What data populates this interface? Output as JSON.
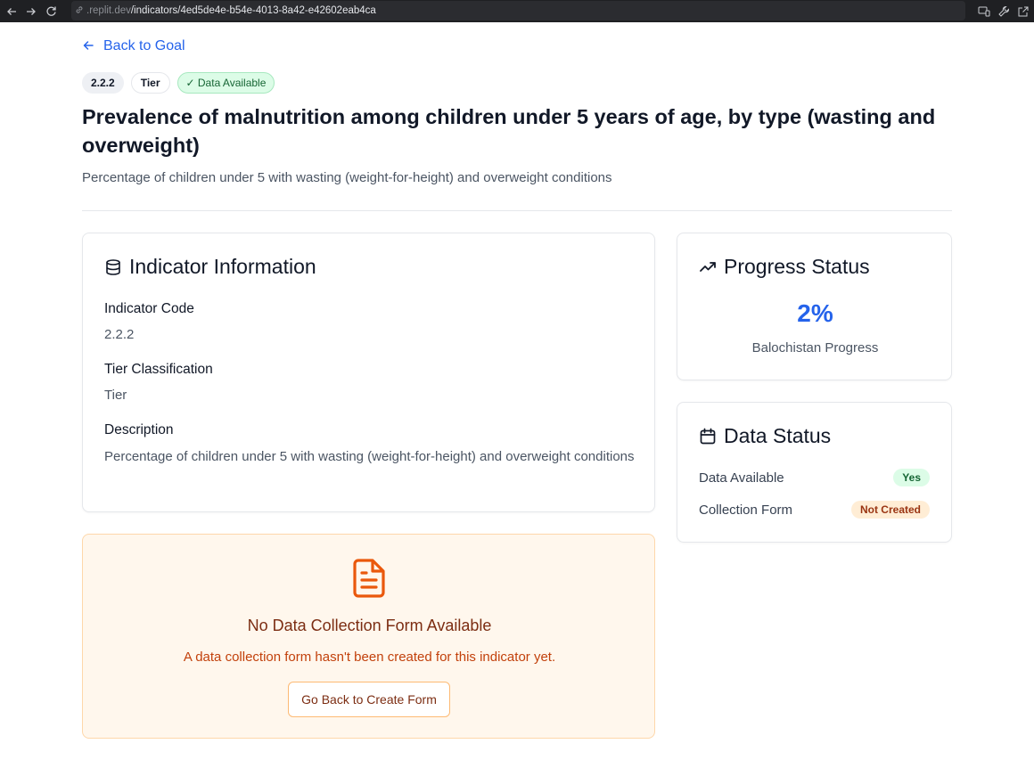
{
  "browser": {
    "url_host": ".replit.dev",
    "url_path": "/indicators/4ed5de4e-b54e-4013-8a42-e42602eab4ca"
  },
  "page": {
    "back_link": "Back to Goal",
    "badges": {
      "code": "2.2.2",
      "tier": "Tier",
      "data_available": "✓ Data Available"
    },
    "title": "Prevalence of malnutrition among children under 5 years of age, by type (wasting and overweight)",
    "subtitle": "Percentage of children under 5 with wasting (weight-for-height) and overweight conditions"
  },
  "indicator_info": {
    "heading": "Indicator Information",
    "code_label": "Indicator Code",
    "code_value": "2.2.2",
    "tier_label": "Tier Classification",
    "tier_value": "Tier",
    "description_label": "Description",
    "description_value": "Percentage of children under 5 with wasting (weight-for-height) and overweight conditions"
  },
  "empty_state": {
    "title": "No Data Collection Form Available",
    "description": "A data collection form hasn't been created for this indicator yet.",
    "button": "Go Back to Create Form"
  },
  "progress": {
    "heading": "Progress Status",
    "value": "2%",
    "label": "Balochistan Progress"
  },
  "data_status": {
    "heading": "Data Status",
    "rows": [
      {
        "label": "Data Available",
        "value": "Yes"
      },
      {
        "label": "Collection Form",
        "value": "Not Created"
      }
    ]
  },
  "colors": {
    "accent": "#2563eb",
    "success": "#166534",
    "warning": "#ea580c"
  }
}
